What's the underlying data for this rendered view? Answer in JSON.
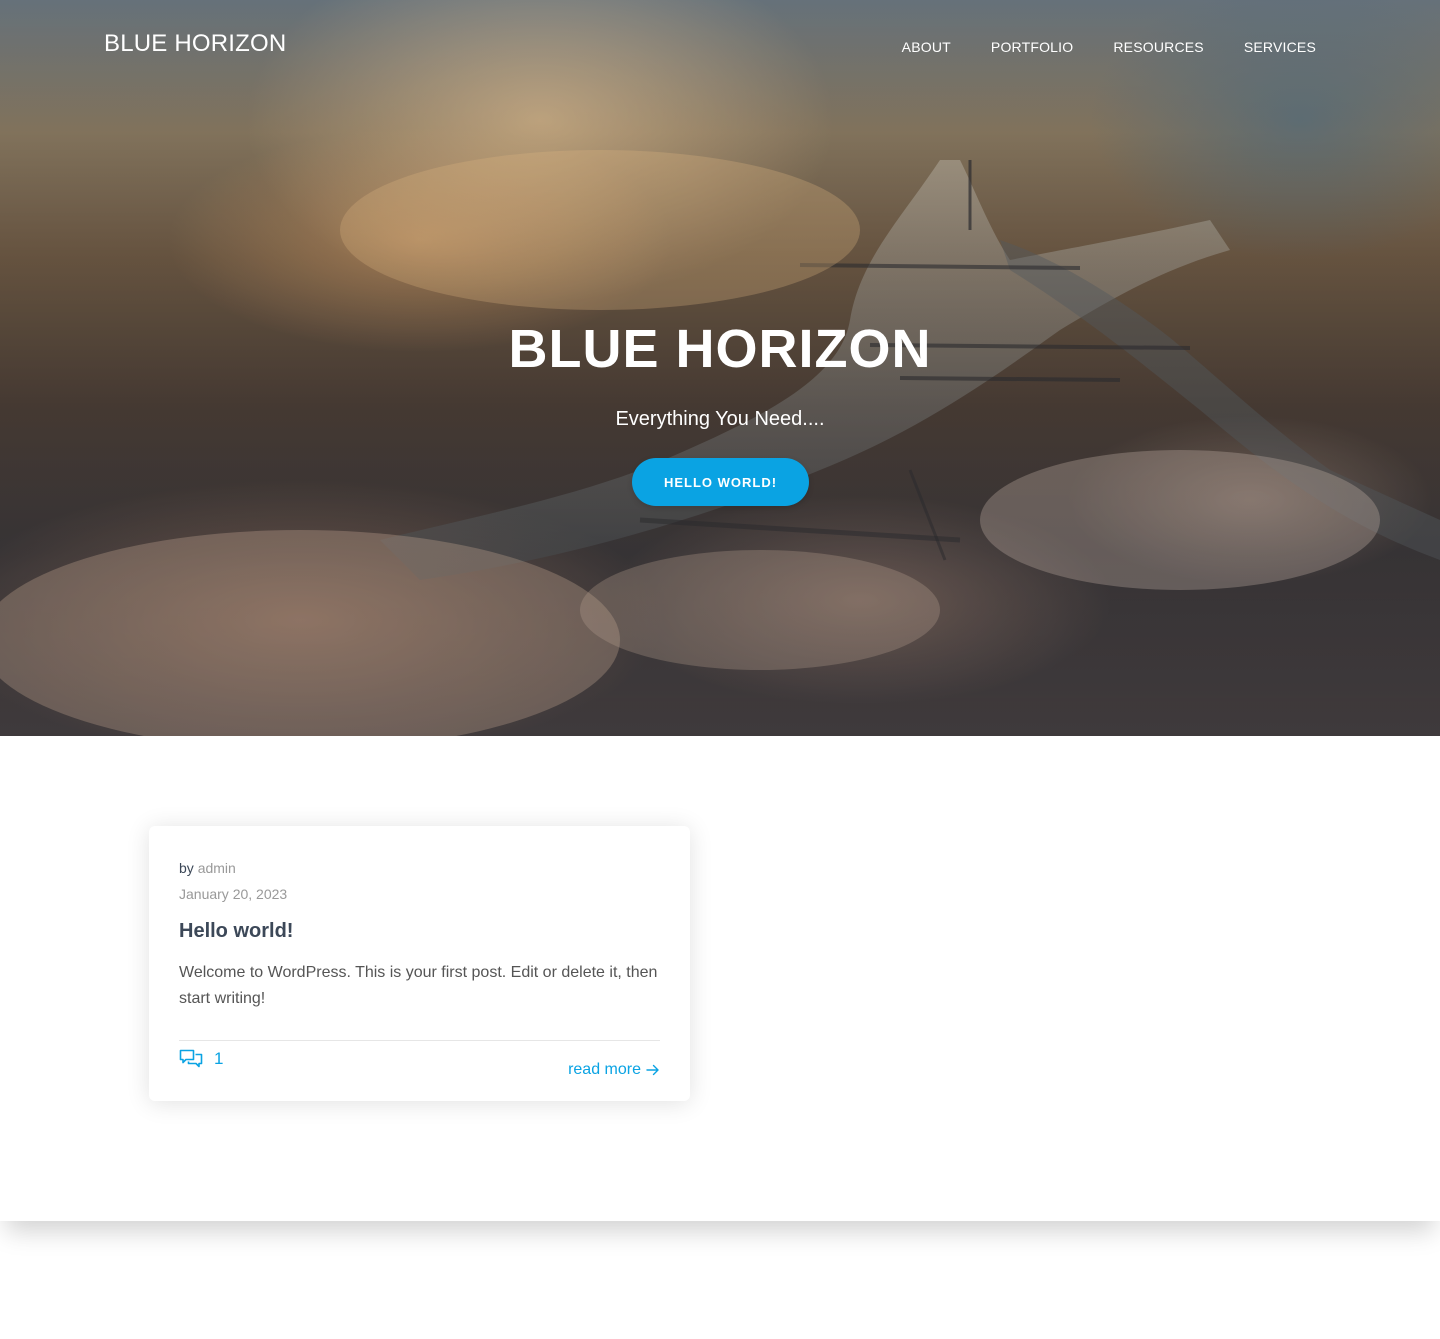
{
  "site": {
    "brand": "BLUE HORIZON"
  },
  "nav": {
    "items": [
      {
        "label": "ABOUT"
      },
      {
        "label": "PORTFOLIO"
      },
      {
        "label": "RESOURCES"
      },
      {
        "label": "SERVICES"
      }
    ]
  },
  "hero": {
    "title": "BLUE HORIZON",
    "subtitle": "Everything You Need....",
    "button_label": "HELLO WORLD!"
  },
  "post": {
    "by_label": "by",
    "author": "admin",
    "date": "January 20, 2023",
    "title": "Hello world!",
    "excerpt": "Welcome to WordPress. This is your first post. Edit or delete it, then start writing!",
    "comment_count": "1",
    "read_more_label": "read more",
    "icons": {
      "comments": "comments-icon",
      "read_more": "arrow-right-icon"
    }
  },
  "colors": {
    "accent": "#0aa3e3",
    "heading": "#3c4858",
    "muted": "#999999",
    "text": "#555555"
  }
}
